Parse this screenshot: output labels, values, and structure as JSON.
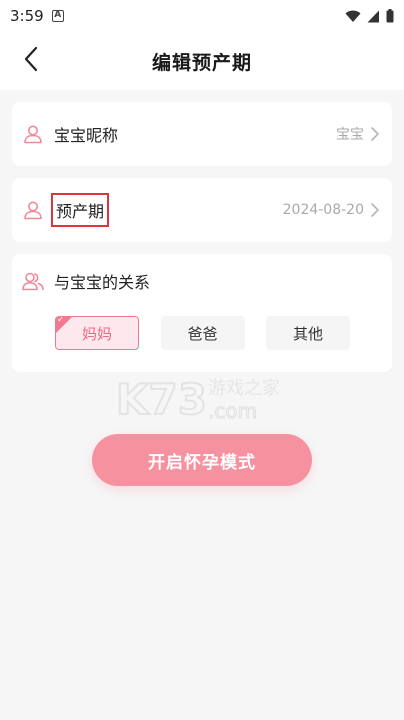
{
  "status_bar": {
    "time": "3:59",
    "notification_letter": "A"
  },
  "header": {
    "title": "编辑预产期"
  },
  "form": {
    "nickname": {
      "label": "宝宝昵称",
      "value": "宝宝",
      "icon": "person-icon"
    },
    "due_date": {
      "label": "预产期",
      "value": "2024-08-20",
      "icon": "person-icon"
    },
    "relation": {
      "label": "与宝宝的关系",
      "icon": "people-icon",
      "options": [
        "妈妈",
        "爸爸",
        "其他"
      ],
      "selected": "妈妈"
    }
  },
  "watermark": {
    "brand": "K73",
    "cn": "游戏之家",
    "domain": ".com"
  },
  "actions": {
    "start_label": "开启怀孕模式"
  },
  "colors": {
    "accent": "#f6919f",
    "accent_light": "#fde9ed",
    "highlight_box": "#d9363e",
    "icon": "#f08a9a"
  }
}
